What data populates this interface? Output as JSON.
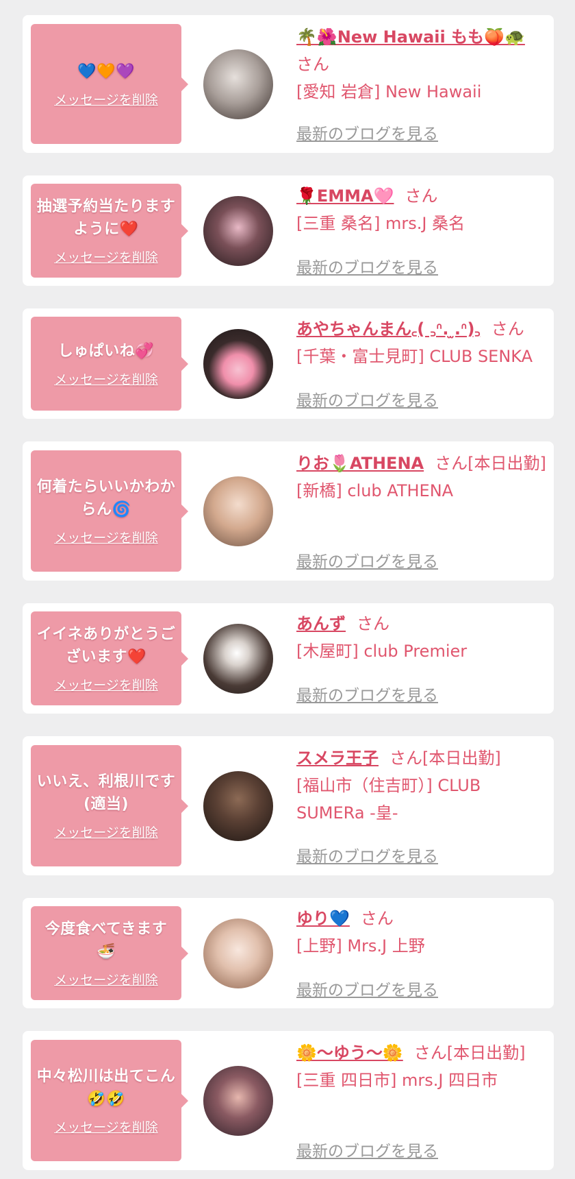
{
  "common": {
    "delete_label": "メッセージを削除",
    "blog_label": "最新のブログを見る",
    "san": "さん"
  },
  "cards": [
    {
      "message": "💙🧡💜",
      "name": "🌴🌺New Hawaii もも🍑🐢",
      "name_suffix": "さん",
      "shop": "[愛知 岩倉] New Hawaii",
      "avatar_colors": [
        "#c9c2bf",
        "#4a3e3a"
      ]
    },
    {
      "message": "抽選予約当たりますように❤️",
      "name": "🌹EMMA🩷",
      "name_suffix": "さん",
      "shop": "[三重 桑名] mrs.J 桑名",
      "avatar_colors": [
        "#3b2b2e",
        "#d9a7b6"
      ]
    },
    {
      "message": "しゅぱいね💞",
      "name": "あやちゃんまん‪‪꜀( ꜆ᐢ. ̫.ᐢ)꜆",
      "name_suffix": "さん",
      "shop": "[千葉・富士見町] CLUB SENKA",
      "avatar_colors": [
        "#2a2424",
        "#f3b3c4"
      ]
    },
    {
      "message": "何着たらいいかわからん🌀",
      "name": "りお🌷ATHENA",
      "name_suffix": "さん[本日出勤]",
      "shop": "[新橋] club ATHENA",
      "avatar_colors": [
        "#e5c7b5",
        "#8a6a55"
      ]
    },
    {
      "message": "イイネありがとうございます❤️",
      "name": "あんず",
      "name_suffix": "さん",
      "shop": "[木屋町] club Premier",
      "avatar_colors": [
        "#f2ede9",
        "#3a2d2a"
      ]
    },
    {
      "message": "いいえ、利根川です(適当)",
      "name": "スメラ王子",
      "name_suffix": "さん[本日出勤]",
      "shop": "[福山市（住吉町）] CLUB SUMERa -皇-",
      "avatar_colors": [
        "#6a4a3a",
        "#1e1714"
      ]
    },
    {
      "message": "今度食べてきます🍜",
      "name": "ゆり💙",
      "name_suffix": "さん",
      "shop": "[上野] Mrs.J 上野",
      "avatar_colors": [
        "#f4e3da",
        "#8b5a40"
      ]
    },
    {
      "message": "中々松川は出てこん🤣🤣",
      "name": "🌼〜ゆう〜🌼",
      "name_suffix": "さん[本日出勤]",
      "shop": "[三重 四日市] mrs.J 四日市",
      "avatar_colors": [
        "#4a3340",
        "#d8a6a0"
      ]
    }
  ]
}
